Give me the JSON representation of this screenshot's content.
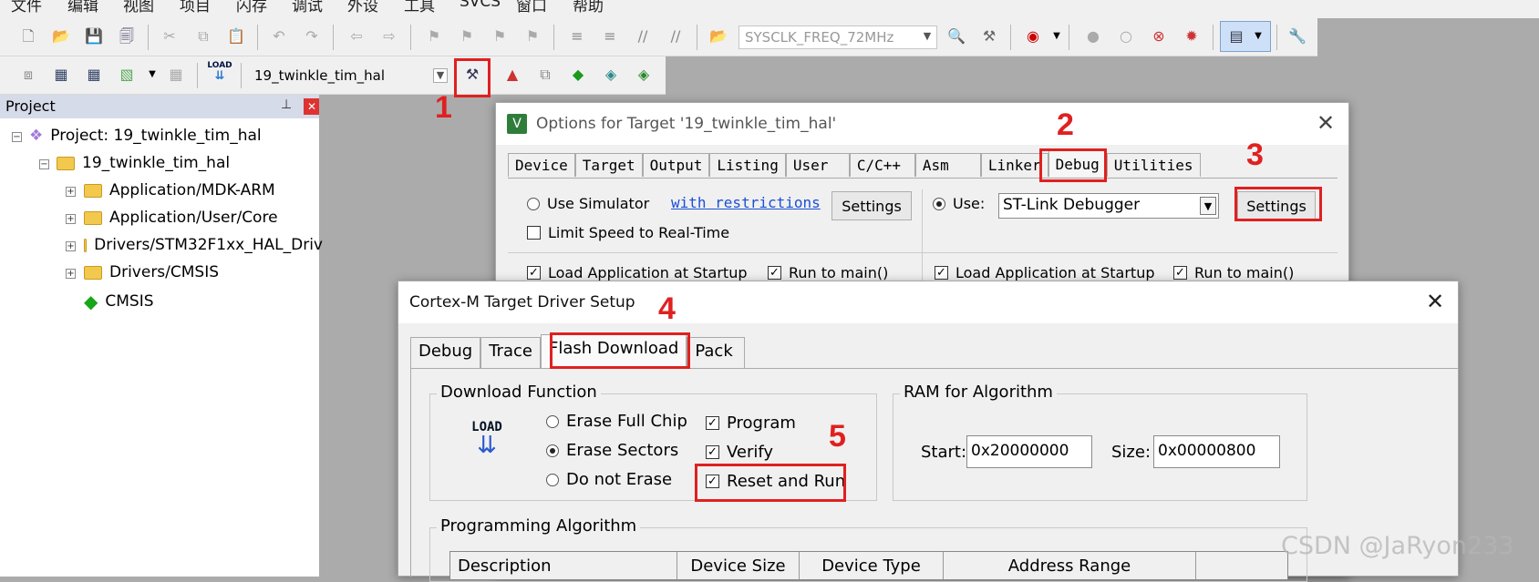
{
  "menubar": {
    "items": [
      "文件",
      "编辑",
      "视图",
      "项目",
      "闪存",
      "调试",
      "外设",
      "工具",
      "SVCS",
      "窗口",
      "帮助"
    ]
  },
  "toolbar1": {
    "target_combo": "SYSCLK_FREQ_72MHz"
  },
  "toolbar2": {
    "project_combo": "19_twinkle_tim_hal",
    "load_label": "LOAD"
  },
  "project_panel": {
    "title": "Project",
    "pin": "ᵖ",
    "close": "x",
    "root": "Project: 19_twinkle_tim_hal",
    "target": "19_twinkle_tim_hal",
    "groups": [
      "Application/MDK-ARM",
      "Application/User/Core",
      "Drivers/STM32F1xx_HAL_Driv",
      "Drivers/CMSIS"
    ],
    "cmsis": "CMSIS"
  },
  "options_dialog": {
    "title": "Options for Target '19_twinkle_tim_hal'",
    "tabs": [
      "Device",
      "Target",
      "Output",
      "Listing",
      "User",
      "C/C++",
      "Asm",
      "Linker",
      "Debug",
      "Utilities"
    ],
    "use_simulator": "Use Simulator",
    "with_restrictions": "with restrictions",
    "settings_left": "Settings",
    "limit_speed": "Limit Speed to Real-Time",
    "use_label": "Use:",
    "debugger": "ST-Link Debugger",
    "settings_right": "Settings",
    "load_app_left": "Load Application at Startup",
    "run_main_left": "Run to main()",
    "load_app_right": "Load Application at Startup",
    "run_main_right": "Run to main()"
  },
  "cortex_dialog": {
    "title": "Cortex-M Target Driver Setup",
    "tabs": [
      "Debug",
      "Trace",
      "Flash Download",
      "Pack"
    ],
    "download_function": "Download Function",
    "load_icon_text": "LOAD",
    "erase_full_chip": "Erase Full Chip",
    "erase_sectors": "Erase Sectors",
    "do_not_erase": "Do not Erase",
    "program": "Program",
    "verify": "Verify",
    "reset_and_run": "Reset and Run",
    "ram_for_algorithm": "RAM for Algorithm",
    "start_label": "Start:",
    "start_value": "0x20000000",
    "size_label": "Size:",
    "size_value": "0x00000800",
    "programming_algorithm": "Programming Algorithm",
    "columns": [
      "Description",
      "Device Size",
      "Device Type",
      "Address Range"
    ]
  },
  "annotations": [
    "1",
    "2",
    "3",
    "4",
    "5"
  ],
  "watermark": "CSDN @JaRyon233",
  "colors": {
    "highlight": "#e02020",
    "panel_header": "#d6dbe9",
    "link": "#1a4fd6"
  }
}
